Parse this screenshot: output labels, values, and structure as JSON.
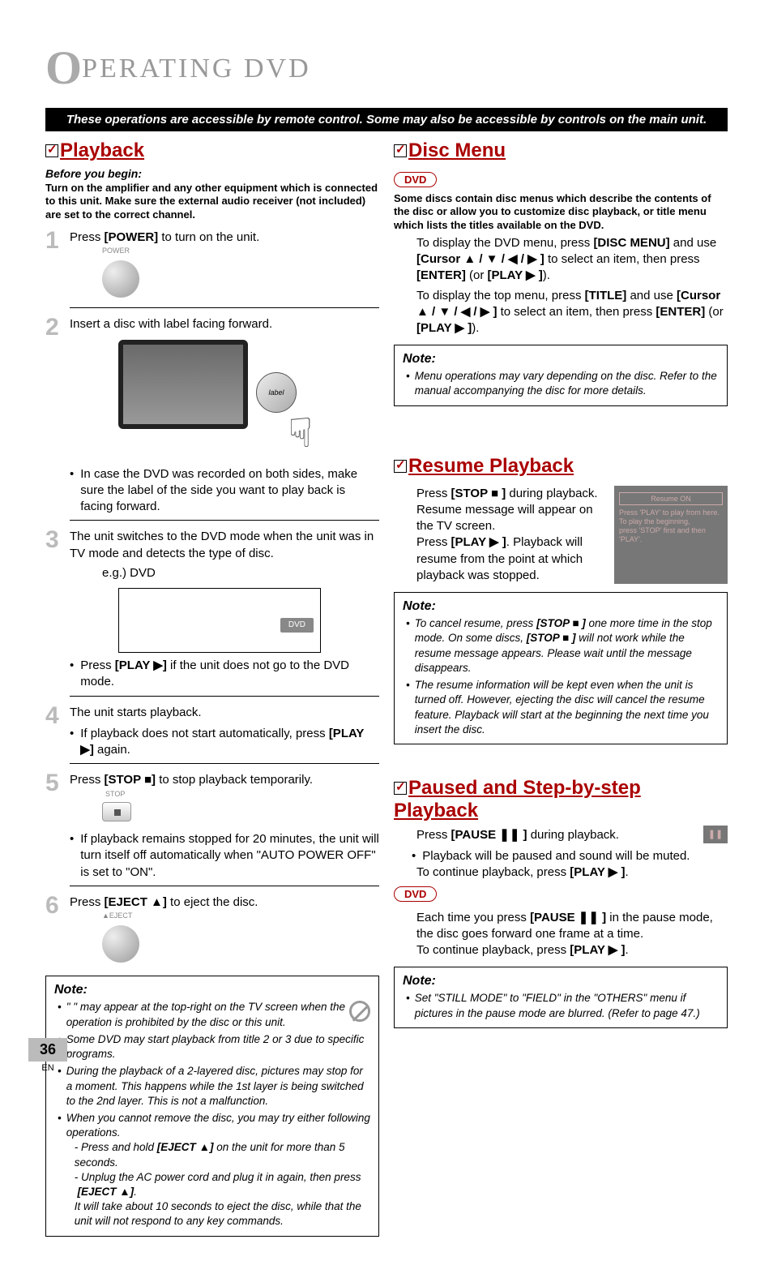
{
  "chapter": {
    "big_letter": "O",
    "rest": "PERATING  DVD"
  },
  "banner": "These operations are accessible by remote control. Some may also be accessible by controls on the main unit.",
  "playback": {
    "title": "Playback",
    "before": "Before you begin:",
    "intro": "Turn on the amplifier and any other equipment which is connected to this unit. Make sure the external audio receiver (not included) are set to the correct channel.",
    "step1": {
      "pre": "Press ",
      "key": "[POWER]",
      "post": " to turn on the unit.",
      "label": "POWER"
    },
    "step2": {
      "text": "Insert a disc with label facing forward.",
      "disc_label": "label",
      "bullet": "In case the DVD was recorded on both sides, make sure the label of the side you want to play back is facing forward."
    },
    "step3": {
      "text": "The unit switches to the DVD mode when the unit was in TV mode and detects the type of disc.",
      "eg": "e.g.) DVD",
      "screen_tag": "DVD",
      "bullet_pre": "Press ",
      "bullet_key": "[PLAY ",
      "bullet_post": "]",
      "bullet_tail": " if the unit does not go to the DVD mode."
    },
    "step4": {
      "text": "The unit starts playback.",
      "bullet_pre": "If playback does not start automatically, press ",
      "bullet_key": "[PLAY ",
      "bullet_post": "]",
      "bullet_tail": " again."
    },
    "step5": {
      "pre": "Press ",
      "key": "[STOP ",
      "key_end": "]",
      "post": " to stop playback temporarily.",
      "label": "STOP",
      "bullet": "If playback remains stopped for 20 minutes, the unit will turn itself off automatically when \"AUTO POWER OFF\" is set to \"ON\"."
    },
    "step6": {
      "pre": "Press ",
      "key": "[EJECT ",
      "key_end": "]",
      "post": " to eject the disc.",
      "label": "EJECT"
    },
    "note": {
      "title": "Note:",
      "n1": "\"      \" may appear at the top-right on the TV screen when the operation is prohibited by the disc or this unit.",
      "n2": "Some DVD may start playback from title 2 or 3 due to specific programs.",
      "n3": "During the playback of a 2-layered disc, pictures may stop for a moment. This happens while the 1st layer is being switched to the 2nd layer. This is not a malfunction.",
      "n4": "When you cannot remove the disc, you may try either following operations.",
      "n4a_pre": "- Press and hold ",
      "n4a_key": "[EJECT ",
      "n4a_end": "]",
      "n4a_post": " on the unit for more than 5 seconds.",
      "n4b": "- Unplug the AC power cord and plug it in again, then press",
      "n4b2_key": "[EJECT ",
      "n4b2_end": "]",
      "n4b2_post": ".",
      "n4c": "It will take about 10 seconds to eject the disc, while that the unit will not respond to any key commands."
    }
  },
  "disc_menu": {
    "title": "Disc Menu",
    "tag": "DVD",
    "intro": "Some discs contain disc menus which describe the contents of the disc or allow you to customize disc playback, or title menu which lists the titles available on the DVD.",
    "p1_pre": "To display the DVD menu, press ",
    "p1_key": "[DISC MENU]",
    "p1_post": " and use ",
    "p1_cur": "[Cursor ▲ / ▼ / ◀ / ▶ ]",
    "p1_mid": " to select an item, then press ",
    "p1_enter": "[ENTER]",
    "p1_or": " (or ",
    "p1_play": "[PLAY ▶ ]",
    "p1_close": ").",
    "p2_pre": "To display the top menu, press ",
    "p2_key": "[TITLE]",
    "p2_post": " and use ",
    "note_title": "Note:",
    "note1": "Menu operations may vary depending on the disc. Refer to the manual accompanying the disc for more details."
  },
  "resume": {
    "title": "Resume Playback",
    "l1_pre": "Press ",
    "l1_key": "[STOP ■ ]",
    "l1_post": " during playback.",
    "l2": "Resume message will appear on the TV screen.",
    "l3_pre": "Press ",
    "l3_key": "[PLAY ▶ ]",
    "l3_post": ". Playback will resume from the point at which playback was stopped.",
    "osd_title": "Resume ON",
    "osd_body": "Press 'PLAY' to play from here.\nTo play the beginning,\npress 'STOP' first and then 'PLAY'.",
    "note_title": "Note:",
    "note1_pre": "To cancel resume, press ",
    "note1_key": "[STOP ■ ]",
    "note1_mid": " one more time in the stop mode. On some discs, ",
    "note1_key2": "[STOP ■ ]",
    "note1_post": " will not work while the resume message appears. Please wait until the message disappears.",
    "note2": "The resume information will be kept even when the unit is turned off. However, ejecting the disc will cancel the resume feature. Playback will start at the beginning the next time you insert the disc."
  },
  "paused": {
    "title": "Paused and Step-by-step Playback",
    "l1_pre": "Press ",
    "l1_key": "[PAUSE ❚❚ ]",
    "l1_post": " during playback.",
    "bullet": "Playback will be paused and sound will be muted.",
    "pause_icon": "❚❚",
    "l2_pre": "To continue playback, press ",
    "l2_key": "[PLAY ▶ ]",
    "l2_post": ".",
    "tag": "DVD",
    "l3_pre": "Each time you press ",
    "l3_key": "[PAUSE ❚❚ ]",
    "l3_post": " in the pause mode, the disc goes forward one frame at a time.",
    "l4_pre": "To continue playback, press ",
    "l4_key": "[PLAY ▶ ]",
    "l4_post": ".",
    "note_title": "Note:",
    "note1": "Set \"STILL MODE\" to \"FIELD\" in the \"OTHERS\" menu if pictures in the pause mode are blurred. (Refer to page 47.)"
  },
  "glyphs": {
    "play": "▶",
    "stop": "■",
    "eject": "▲",
    "up": "▲",
    "down": "▼",
    "left": "◀",
    "right": "▶",
    "pause": "❚❚"
  },
  "footer": {
    "page": "36",
    "lang": "EN"
  }
}
